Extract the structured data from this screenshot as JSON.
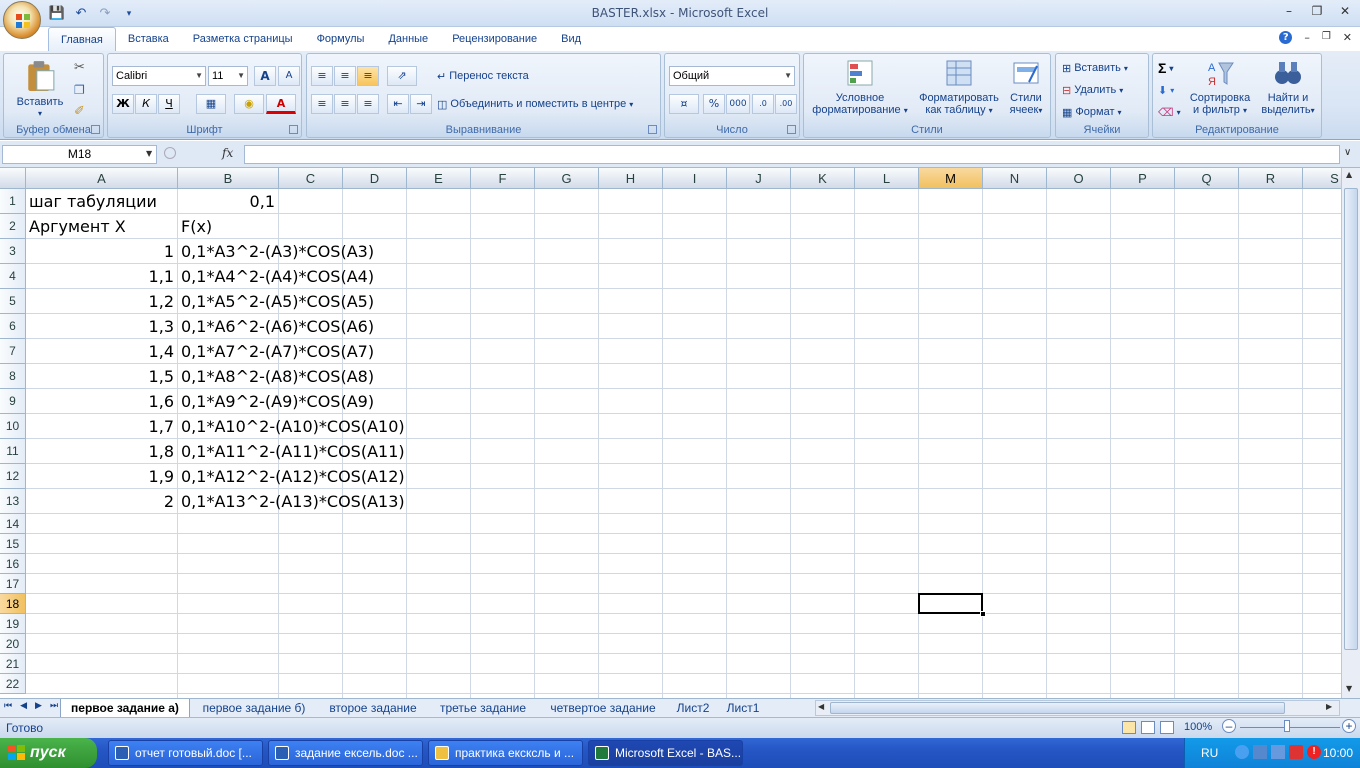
{
  "window": {
    "title": "BASTER.xlsx - Microsoft Excel"
  },
  "ribbon_tabs": [
    "Главная",
    "Вставка",
    "Разметка страницы",
    "Формулы",
    "Данные",
    "Рецензирование",
    "Вид"
  ],
  "clipboard": {
    "paste": "Вставить",
    "group": "Буфер обмена"
  },
  "font": {
    "name": "Calibri",
    "size": "11",
    "bold": "Ж",
    "italic": "К",
    "underline": "Ч",
    "color_letter": "А",
    "group": "Шрифт"
  },
  "alignment": {
    "wrap": "Перенос текста",
    "merge": "Объединить и поместить в центре",
    "group": "Выравнивание"
  },
  "number": {
    "format": "Общий",
    "percent": "%",
    "thousands": "000",
    "group": "Число"
  },
  "styles": {
    "conditional": "Условное\nформатирование",
    "cond1": "Условное",
    "cond2": "форматирование",
    "table1": "Форматировать",
    "table2": "как таблицу",
    "cell1": "Стили",
    "cell2": "ячеек",
    "group": "Стили"
  },
  "cells": {
    "insert": "Вставить",
    "delete": "Удалить",
    "format": "Формат",
    "group": "Ячейки"
  },
  "editing": {
    "sort1": "Сортировка",
    "sort2": "и фильтр",
    "find1": "Найти и",
    "find2": "выделить",
    "group": "Редактирование"
  },
  "formula_bar": {
    "name_box": "M18",
    "fx": "fx",
    "value": ""
  },
  "columns": [
    "A",
    "B",
    "C",
    "D",
    "E",
    "F",
    "G",
    "H",
    "I",
    "J",
    "K",
    "L",
    "M",
    "N",
    "O",
    "P",
    "Q",
    "R",
    "S"
  ],
  "rows": [
    "1",
    "2",
    "3",
    "4",
    "5",
    "6",
    "7",
    "8",
    "9",
    "10",
    "11",
    "12",
    "13",
    "14",
    "15",
    "16",
    "17",
    "18",
    "19",
    "20",
    "21",
    "22"
  ],
  "selected_cell": "M18",
  "cells_data": [
    {
      "row": 1,
      "a": "шаг табуляции",
      "b": "0,1",
      "b_align": "right"
    },
    {
      "row": 2,
      "a": "Аргумент X",
      "b": "F(x)",
      "b_align": "left"
    },
    {
      "row": 3,
      "a": "1",
      "b": "0,1*A3^2-(A3)*COS(A3)"
    },
    {
      "row": 4,
      "a": "1,1",
      "b": "0,1*A4^2-(A4)*COS(A4)"
    },
    {
      "row": 5,
      "a": "1,2",
      "b": "0,1*A5^2-(A5)*COS(A5)"
    },
    {
      "row": 6,
      "a": "1,3",
      "b": "0,1*A6^2-(A6)*COS(A6)"
    },
    {
      "row": 7,
      "a": "1,4",
      "b": "0,1*A7^2-(A7)*COS(A7)"
    },
    {
      "row": 8,
      "a": "1,5",
      "b": "0,1*A8^2-(A8)*COS(A8)"
    },
    {
      "row": 9,
      "a": "1,6",
      "b": "0,1*A9^2-(A9)*COS(A9)"
    },
    {
      "row": 10,
      "a": "1,7",
      "b": "0,1*A10^2-(A10)*COS(A10)"
    },
    {
      "row": 11,
      "a": "1,8",
      "b": "0,1*A11^2-(A11)*COS(A11)"
    },
    {
      "row": 12,
      "a": "1,9",
      "b": "0,1*A12^2-(A12)*COS(A12)"
    },
    {
      "row": 13,
      "a": "2",
      "b": "0,1*A13^2-(A13)*COS(A13)"
    }
  ],
  "sheets": [
    {
      "name": "первое задание а)",
      "active": true
    },
    {
      "name": "первое задание б)",
      "active": false
    },
    {
      "name": "второе задание",
      "active": false
    },
    {
      "name": "третье задание",
      "active": false
    },
    {
      "name": "четвертое задание",
      "active": false
    },
    {
      "name": "Лист2",
      "active": false
    },
    {
      "name": "Лист1",
      "active": false
    }
  ],
  "status": {
    "text": "Готово",
    "zoom": "100%"
  },
  "taskbar": {
    "start": "пуск",
    "tasks": [
      {
        "label": "отчет готовый.doc [...",
        "icon": "word-icon",
        "active": false
      },
      {
        "label": "задание ексель.doc ...",
        "icon": "word-icon",
        "active": false
      },
      {
        "label": "практика ексксль и ...",
        "icon": "folder-icon",
        "active": false
      },
      {
        "label": "Microsoft Excel - BAS...",
        "icon": "excel-icon",
        "active": true
      }
    ],
    "lang": "RU",
    "clock": "10:00"
  }
}
